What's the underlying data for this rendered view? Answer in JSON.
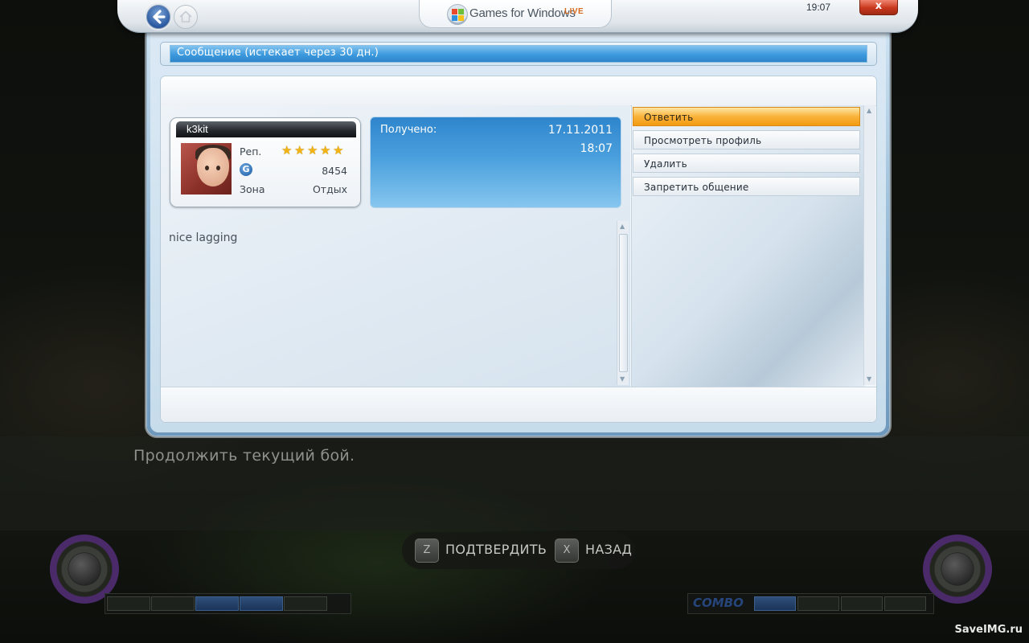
{
  "header": {
    "logo_text": "Games for Windows",
    "logo_live": "LIVE",
    "clock": "19:07",
    "close_label": "x",
    "icons": [
      "back-arrow-icon",
      "home-icon",
      "windows-logo-icon"
    ]
  },
  "message_panel": {
    "title": "Сообщение (истекает через 30 дн.)",
    "sender_card": {
      "gamertag": "k3kit",
      "rep_label": "Реп.",
      "rep_stars": 5,
      "rep_max": 5,
      "gamerscore": "8454",
      "gamerscore_icon": "G",
      "zone_label": "Зона",
      "zone_value": "Отдых"
    },
    "received": {
      "label": "Получено:",
      "date": "17.11.2011",
      "time": "18:07"
    },
    "body": "nice lagging",
    "actions": [
      {
        "label": "Ответить",
        "selected": true
      },
      {
        "label": "Просмотреть профиль",
        "selected": false
      },
      {
        "label": "Удалить",
        "selected": false
      },
      {
        "label": "Запретить общение",
        "selected": false
      }
    ]
  },
  "game_overlay": {
    "resume_text": "Продолжить текущий бой.",
    "hints": [
      {
        "key": "Z",
        "label": "ПОДТВЕРДИТЬ"
      },
      {
        "key": "X",
        "label": "НАЗАД"
      }
    ],
    "combo_label": "COMBO"
  },
  "watermark": "SaveIMG.ru",
  "colors": {
    "accent_blue": "#3c99dd",
    "selected_orange": "#f39a12",
    "close_red": "#c8371e",
    "star_gold": "#f2b414"
  }
}
